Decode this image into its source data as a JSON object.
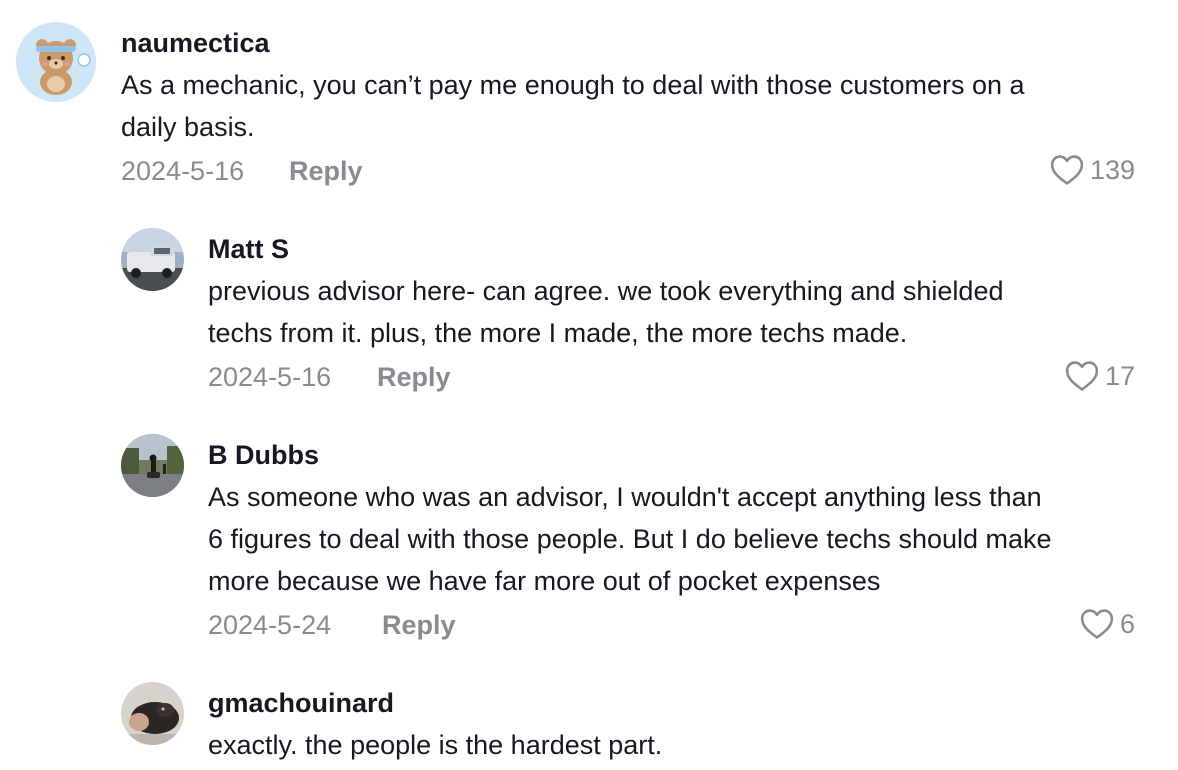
{
  "comments": [
    {
      "username": "naumectica",
      "text": "As a mechanic, you can’t pay me enough to deal with those customers on a\ndaily basis.",
      "date": "2024-5-16",
      "reply_label": "Reply",
      "likes": "139",
      "avatar_icon": "bear-avatar"
    },
    {
      "username": "Matt S",
      "text": "previous advisor here- can agree. we took everything and shielded\ntechs from it. plus, the more I made, the more techs made.",
      "date": "2024-5-16",
      "reply_label": "Reply",
      "likes": "17",
      "avatar_icon": "truck-photo-avatar"
    },
    {
      "username": "B Dubbs",
      "text": "As someone who was an advisor, I wouldn't accept anything less than\n6 figures to deal with those people. But I do believe techs should make\nmore because we have far more out of pocket expenses",
      "date": "2024-5-24",
      "reply_label": "Reply",
      "likes": "6",
      "avatar_icon": "motorcycle-photo-avatar"
    },
    {
      "username": "gmachouinard",
      "text": "exactly. the people is the hardest part.",
      "avatar_icon": "pet-photo-avatar"
    }
  ],
  "colors": {
    "primary_text": "#161823",
    "secondary_text": "#8a8b91",
    "heart_outline": "#8a8b91"
  }
}
